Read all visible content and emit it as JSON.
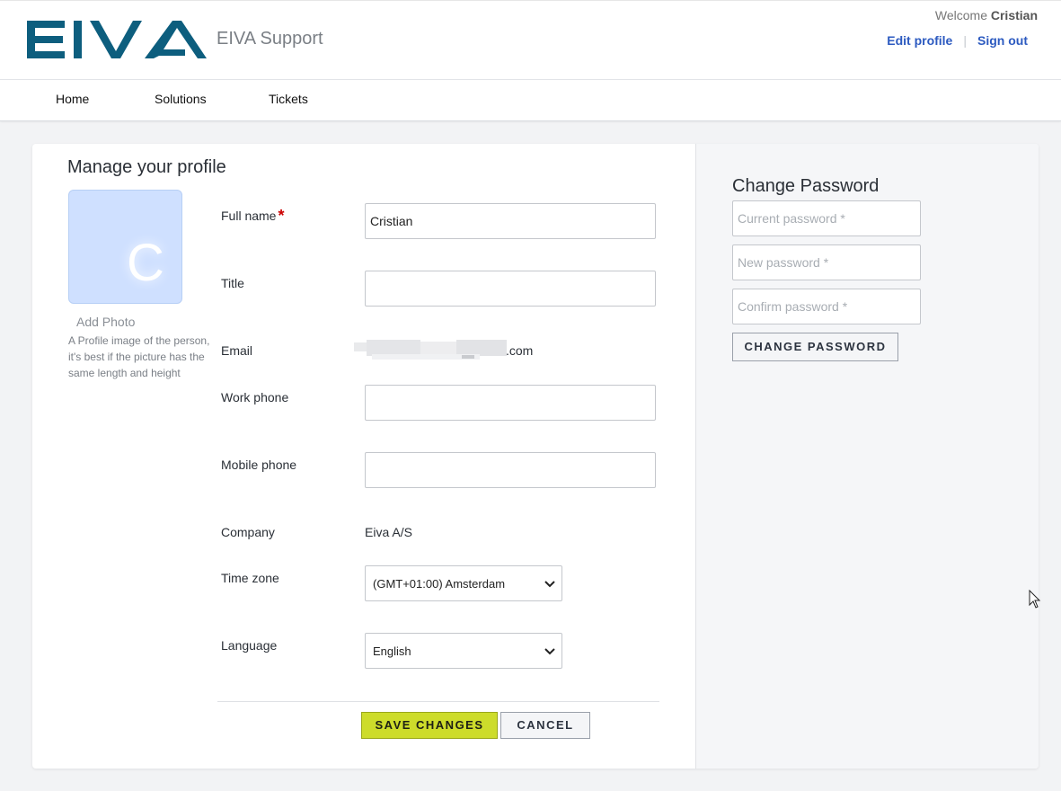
{
  "header": {
    "site_name": "EIVA Support",
    "welcome_prefix": "Welcome",
    "user_name": "Cristian",
    "edit_profile": "Edit profile",
    "separator": "|",
    "sign_out": "Sign out",
    "logo_color": "#0d5e7e"
  },
  "nav": {
    "items": [
      "Home",
      "Solutions",
      "Tickets"
    ]
  },
  "profile": {
    "title": "Manage your profile",
    "avatar_letter": "C",
    "add_photo": "Add Photo",
    "photo_help": "A Profile image of the person, it's best if the picture has the same length and height",
    "fields": {
      "full_name_label": "Full name",
      "required_mark": "*",
      "full_name_value": "Cristian",
      "title_label": "Title",
      "title_value": "",
      "email_label": "Email",
      "email_visible_suffix": ".com",
      "work_phone_label": "Work phone",
      "work_phone_value": "",
      "mobile_phone_label": "Mobile phone",
      "mobile_phone_value": "",
      "company_label": "Company",
      "company_value": "Eiva A/S",
      "timezone_label": "Time zone",
      "timezone_value": "(GMT+01:00) Amsterdam",
      "language_label": "Language",
      "language_value": "English"
    },
    "save_button": "SAVE CHANGES",
    "cancel_button": "CANCEL"
  },
  "password": {
    "title": "Change Password",
    "current_placeholder": "Current password *",
    "new_placeholder": "New password *",
    "confirm_placeholder": "Confirm password *",
    "button": "CHANGE PASSWORD"
  },
  "colors": {
    "accent_link": "#2c5ac0",
    "save_button_bg": "#cddc2b",
    "required": "#cc0000"
  }
}
